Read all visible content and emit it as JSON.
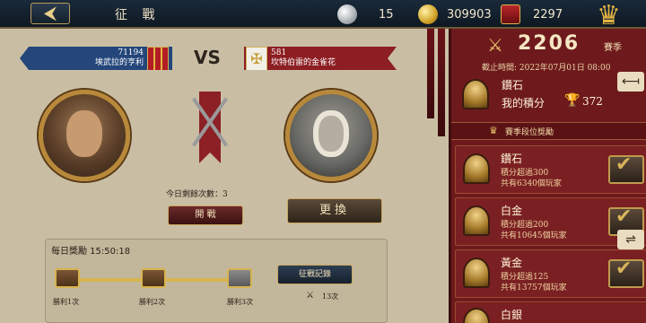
{
  "topbar": {
    "back_glyph": "⮜",
    "title": "征 戰",
    "silver": "15",
    "gold": "309903",
    "crest": "2297",
    "crown_glyph": "♛"
  },
  "left_player": {
    "score": "71194",
    "name": "埃武拉的亨利"
  },
  "vs": "VS",
  "right_player": {
    "score": "581",
    "name": "坎特伯雷的金雀花"
  },
  "battle": {
    "remaining": "今日剩餘次數：3",
    "attack_label": "開 戰",
    "swap_label": "更換"
  },
  "daily": {
    "title": "每日獎勵 15:50:18",
    "wins": [
      "勝利1次",
      "勝利2次",
      "勝利3次"
    ],
    "record_label": "征戰記錄",
    "count": "13次"
  },
  "season": {
    "score": "2206",
    "label": "賽季",
    "deadline": "截止時間: 2022年07月01日 08:00",
    "my_tier": "鑽石",
    "my_points_label": "我的積分",
    "my_points": "372",
    "section_title": "賽季段位獎勵",
    "tiers": [
      {
        "name": "鑽石",
        "req": "積分超過300",
        "players": "共有6340個玩家"
      },
      {
        "name": "白金",
        "req": "積分超過200",
        "players": "共有10645個玩家"
      },
      {
        "name": "黃金",
        "req": "積分超過125",
        "players": "共有13757個玩家"
      },
      {
        "name": "白銀",
        "req": "",
        "players": ""
      }
    ]
  },
  "side_buttons": [
    "⟻",
    "⇌"
  ]
}
